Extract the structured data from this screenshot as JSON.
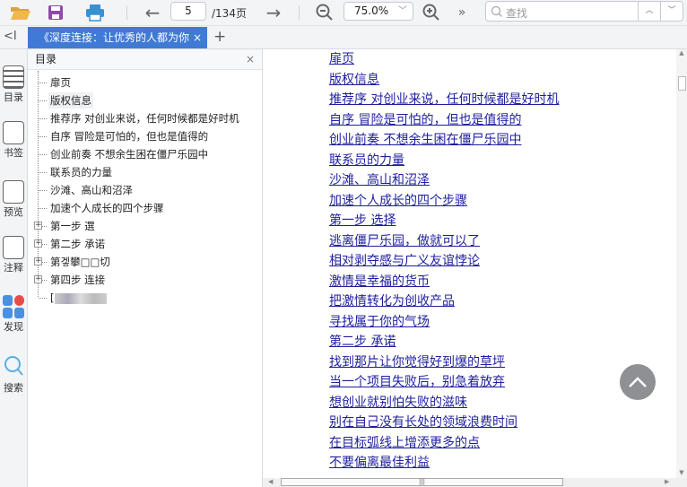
{
  "toolbar": {
    "page_current": "5",
    "page_total": "/134页",
    "zoom": "75.0%",
    "search_placeholder": "查找",
    "more": "»"
  },
  "tab": {
    "title": "《深度连接：让优秀的人都为你",
    "close": "×",
    "add": "+",
    "collapse": "<I"
  },
  "rail": [
    "目录",
    "书签",
    "预览",
    "注释",
    "发现",
    "搜索"
  ],
  "toc": {
    "title": "目录",
    "close": "×",
    "items": [
      {
        "label": "扉页",
        "expandable": false
      },
      {
        "label": "版权信息",
        "expandable": false
      },
      {
        "label": "推荐序 对创业来说，任何时候都是好时机",
        "expandable": false
      },
      {
        "label": "自序 冒险是可怕的，但也是值得的",
        "expandable": false
      },
      {
        "label": "创业前奏 不想余生困在僵尸乐园中",
        "expandable": false
      },
      {
        "label": "联系员的力量",
        "expandable": false
      },
      {
        "label": "沙滩、高山和沼泽",
        "expandable": false
      },
      {
        "label": "加速个人成长的四个步骤",
        "expandable": false
      },
      {
        "label": "第一步 選",
        "expandable": true
      },
      {
        "label": "第二步 承诺",
        "expandable": true
      },
      {
        "label": "第겧攀□□切",
        "expandable": true
      },
      {
        "label": "第四步 连接",
        "expandable": true
      },
      {
        "label": "[",
        "expandable": false
      }
    ]
  },
  "content": {
    "links": [
      "扉页",
      "版权信息",
      "推荐序 对创业来说，任何时候都是好时机",
      "自序 冒险是可怕的，但也是值得的",
      "创业前奏 不想余生困在僵尸乐园中",
      "联系员的力量",
      "沙滩、高山和沼泽",
      "加速个人成长的四个步骤",
      "第一步 选择",
      "逃离僵尸乐园，做就可以了",
      "相对剥夺感与广义友谊悖论",
      "激情是幸福的货币",
      "把激情转化为创收产品",
      "寻找属于你的气场",
      "第二步 承诺",
      "找到那片让你觉得好到爆的草坪",
      "当一个项目失败后，别急着放弃",
      "想创业就别怕失败的滋味",
      "别在自己没有长处的领域浪费时间",
      "在目标弧线上增添更多的点",
      "不要偏离最佳利益"
    ]
  },
  "colors": {
    "accent": "#3f7ad6",
    "link": "#1f1f9e"
  }
}
